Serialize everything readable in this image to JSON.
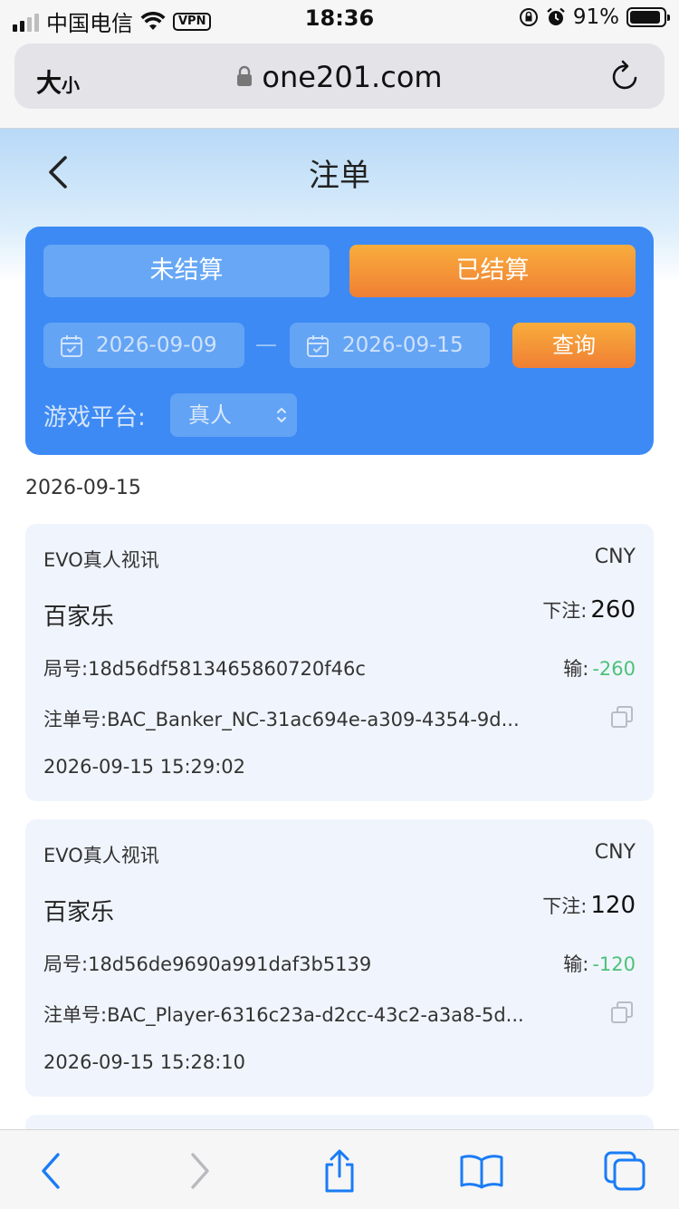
{
  "status_bar": {
    "carrier": "中国电信",
    "vpn": "VPN",
    "time": "18:36",
    "battery_percent": "91%",
    "battery_level": 0.91
  },
  "browser": {
    "text_size_label": "大",
    "text_size_small": "小",
    "url": "one201.com"
  },
  "header": {
    "title": "注单"
  },
  "filter": {
    "tabs": [
      {
        "label": "未结算",
        "active": false
      },
      {
        "label": "已结算",
        "active": true
      }
    ],
    "date_start": "2026-09-09",
    "date_separator": "—",
    "date_end": "2026-09-15",
    "query_label": "查询",
    "platform_label": "游戏平台:",
    "platform_value": "真人"
  },
  "date_group": "2026-09-15",
  "records": [
    {
      "platform": "EVO真人视讯",
      "currency": "CNY",
      "game": "百家乐",
      "bet_label": "下注:",
      "bet_amount": "260",
      "round_label": "局号:",
      "round_id": "18d56df5813465860720f46c",
      "result_label": "输:",
      "result_amount": "-260",
      "order_label": "注单号:",
      "order_id": "BAC_Banker_NC-31ac694e-a309-4354-9d...",
      "time": "2026-09-15 15:29:02"
    },
    {
      "platform": "EVO真人视讯",
      "currency": "CNY",
      "game": "百家乐",
      "bet_label": "下注:",
      "bet_amount": "120",
      "round_label": "局号:",
      "round_id": "18d56de9690a991daf3b5139",
      "result_label": "输:",
      "result_amount": "-120",
      "order_label": "注单号:",
      "order_id": "BAC_Player-6316c23a-d2cc-43c2-a3a8-5d...",
      "time": "2026-09-15 15:28:10"
    }
  ],
  "colors": {
    "primary_blue": "#3d8af5",
    "orange": "#f07f34",
    "result_green": "#4cc27a",
    "safari_blue": "#1a7cf5"
  },
  "toolbar_icons": [
    "chevron-left-icon",
    "chevron-right-icon",
    "share-icon",
    "bookmarks-icon",
    "tabs-icon"
  ]
}
